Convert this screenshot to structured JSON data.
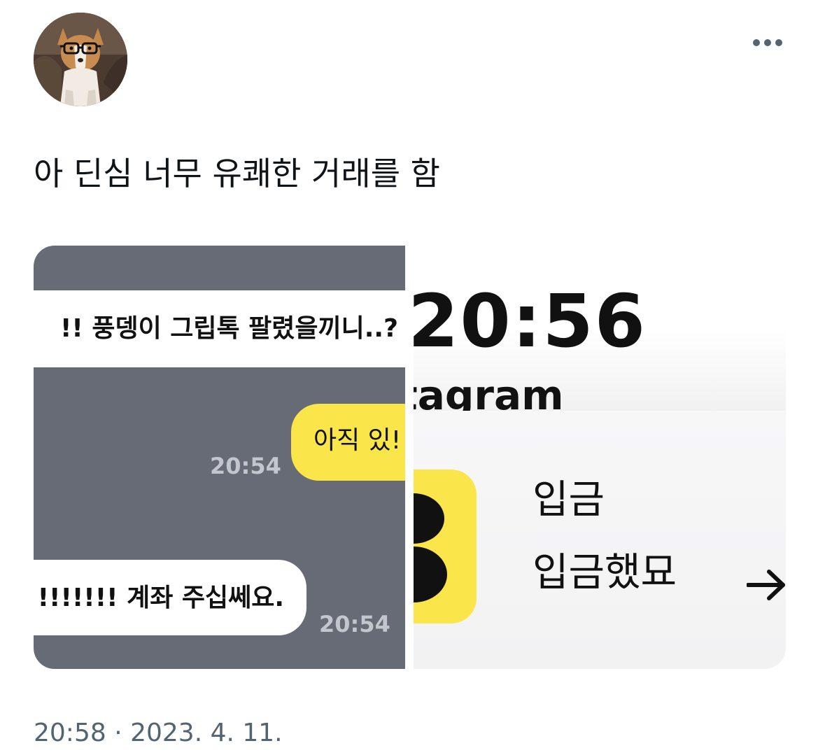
{
  "tweet": {
    "text": "아 딘심 너무 유쾌한 거래를 함",
    "timestamp": "20:58 · 2023. 4. 11.",
    "avatar_icon": "corgi-with-glasses-avatar",
    "more_icon": "more-options-icon"
  },
  "media": {
    "chat": {
      "partial_message": "!! 풍뎅이 그립톡 팔렸을끼니..?",
      "my_reply": "아직 있!",
      "my_reply_time": "20:54",
      "their_reply": "!!!!!!! 계좌 주십쎄요.",
      "their_reply_time": "20:54",
      "colors": {
        "background": "#666b76",
        "my_bubble": "#fae54a",
        "their_bubble": "#ffffff"
      }
    },
    "notification": {
      "clock": "20:56",
      "app_name_partial": "tagram",
      "title": "입금",
      "body": "입금했묘",
      "arrow_icon": "arrow-right-icon",
      "app_icon": "kakao-yellow-app-icon"
    }
  }
}
